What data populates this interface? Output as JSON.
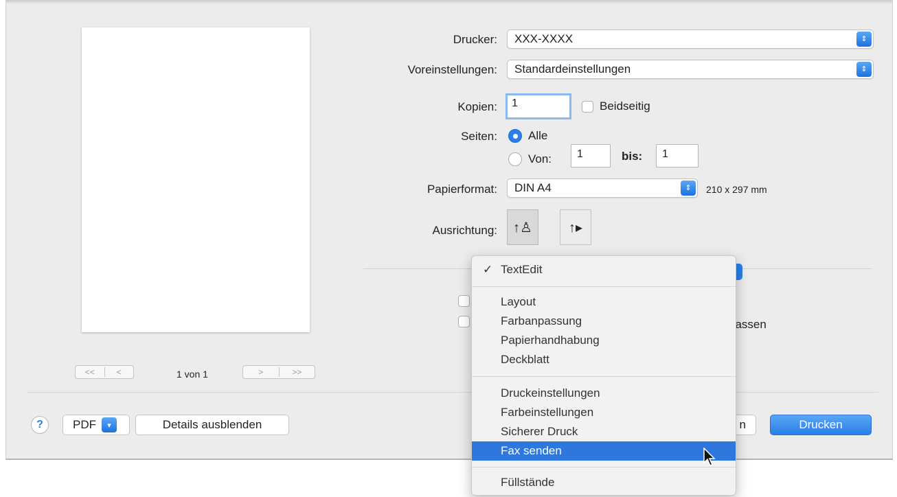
{
  "printer": {
    "label": "Drucker:",
    "value": "XXX-XXXX"
  },
  "presets": {
    "label": "Voreinstellungen:",
    "value": "Standardeinstellungen"
  },
  "copies": {
    "label": "Kopien:",
    "value": "1",
    "duplex_label": "Beidseitig"
  },
  "pages": {
    "label": "Seiten:",
    "all_label": "Alle",
    "from_label": "Von:",
    "from_value": "1",
    "to_label": "bis:",
    "to_value": "1"
  },
  "paper": {
    "label": "Papierformat:",
    "value": "DIN A4",
    "size_text": "210 x 297 mm"
  },
  "orientation": {
    "label": "Ausrichtung:",
    "portrait_icon": "portrait-orientation-icon",
    "landscape_icon": "landscape-orientation-icon"
  },
  "preview": {
    "page_count": "1 von 1"
  },
  "behind_menu": {
    "partial_text": "passen",
    "cancel_partial": "n"
  },
  "footer": {
    "help": "?",
    "pdf_label": "PDF",
    "details_label": "Details ausblenden",
    "print_label": "Drucken"
  },
  "menu": {
    "checked": "✓",
    "items": [
      "TextEdit",
      "Layout",
      "Farbanpassung",
      "Papierhandhabung",
      "Deckblatt",
      "Druckeinstellungen",
      "Farbeinstellungen",
      "Sicherer Druck",
      "Fax senden",
      "Füllstände"
    ],
    "active_item": "Fax senden"
  },
  "colors": {
    "accent": "#2a7fe8",
    "menu_highlight": "#2d77dd",
    "dialog_bg": "#ececec"
  }
}
